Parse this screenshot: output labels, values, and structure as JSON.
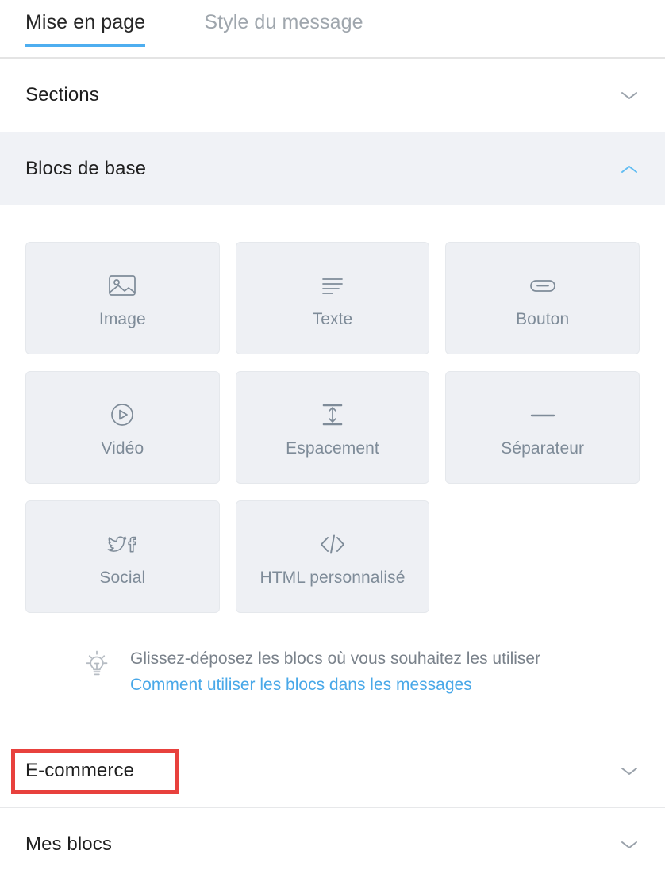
{
  "tabs": [
    {
      "label": "Mise en page",
      "active": true
    },
    {
      "label": "Style du message",
      "active": false
    }
  ],
  "accent_color": "#4eaef0",
  "annotation_color": "#e8413d",
  "sections": {
    "sections_header": {
      "title": "Sections",
      "chevron": "chevron-down-icon",
      "expanded": false
    },
    "basic_blocks_header": {
      "title": "Blocs de base",
      "chevron": "chevron-up-icon",
      "expanded": true
    },
    "ecommerce_header": {
      "title": "E-commerce",
      "chevron": "chevron-down-icon",
      "expanded": false,
      "highlighted": true
    },
    "my_blocks_header": {
      "title": "Mes blocs",
      "chevron": "chevron-down-icon",
      "expanded": false
    }
  },
  "blocks": [
    {
      "label": "Image",
      "icon": "image-icon"
    },
    {
      "label": "Texte",
      "icon": "text-lines-icon"
    },
    {
      "label": "Bouton",
      "icon": "button-pill-icon"
    },
    {
      "label": "Vidéo",
      "icon": "play-circle-icon"
    },
    {
      "label": "Espacement",
      "icon": "vertical-spacing-icon"
    },
    {
      "label": "Séparateur",
      "icon": "horizontal-line-icon"
    },
    {
      "label": "Social",
      "icon": "social-twitter-facebook-icon"
    },
    {
      "label": "HTML personnalisé",
      "icon": "code-brackets-icon"
    }
  ],
  "hint": {
    "icon": "lightbulb-icon",
    "text": "Glissez-déposez les blocs où vous souhaitez les utiliser",
    "link": "Comment utiliser les blocs dans les messages"
  }
}
